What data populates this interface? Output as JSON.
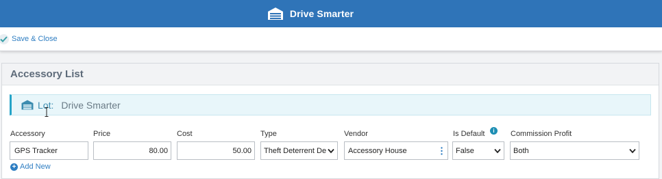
{
  "header": {
    "title": "Drive Smarter",
    "icon": "garage-icon",
    "bg_color": "#2f74b8"
  },
  "toolbar": {
    "save_close_label": "Save & Close"
  },
  "panel": {
    "title": "Accessory List",
    "lot": {
      "label": "Lot:",
      "value": "Drive Smarter"
    },
    "fields": {
      "accessory": {
        "label": "Accessory",
        "value": "GPS Tracker"
      },
      "price": {
        "label": "Price",
        "value": "80.00"
      },
      "cost": {
        "label": "Cost",
        "value": "50.00"
      },
      "type": {
        "label": "Type",
        "value": "Theft Deterrent De"
      },
      "vendor": {
        "label": "Vendor",
        "value": "Accessory House"
      },
      "is_default": {
        "label": "Is Default",
        "value": "False"
      },
      "commission_profit": {
        "label": "Commission Profit",
        "value": "Both"
      }
    },
    "add_new_label": "Add New"
  }
}
